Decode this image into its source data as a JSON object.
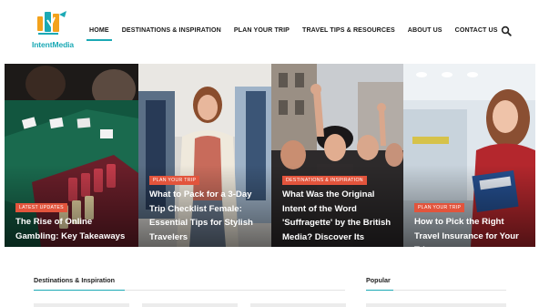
{
  "brand": {
    "name": "IntentMedia",
    "accent": "#1ba9b5",
    "badge_color": "#e2543c"
  },
  "nav": {
    "items": [
      {
        "label": "HOME",
        "active": true
      },
      {
        "label": "DESTINATIONS & INSPIRATION"
      },
      {
        "label": "PLAN YOUR TRIP"
      },
      {
        "label": "TRAVEL TIPS & RESOURCES"
      },
      {
        "label": "ABOUT US"
      },
      {
        "label": "CONTACT US"
      }
    ],
    "search_icon": "search-icon"
  },
  "hero": {
    "cards": [
      {
        "category": "LATEST UPDATES",
        "title": "The Rise of Online Gambling: Key Takeaways",
        "image": "casino-table-photo"
      },
      {
        "category": "PLAN YOUR TRIP",
        "title": "What to Pack for a 3-Day Trip Checklist Female: Essential Tips for Stylish Travelers",
        "image": "woman-with-clothes-rack-photo"
      },
      {
        "category": "DESTINATIONS & INSPIRATION",
        "title": "What Was the Original Intent of the Word 'Suffragette' by the British Media? Discover Its Surprising Evolution",
        "image": "suffragette-protest-photo"
      },
      {
        "category": "PLAN YOUR TRIP",
        "title": "How to Pick the Right Travel Insurance for Your Trip",
        "image": "woman-at-airport-photo"
      }
    ]
  },
  "sections": {
    "left_title": "Destinations & Inspiration",
    "right_title": "Popular"
  }
}
